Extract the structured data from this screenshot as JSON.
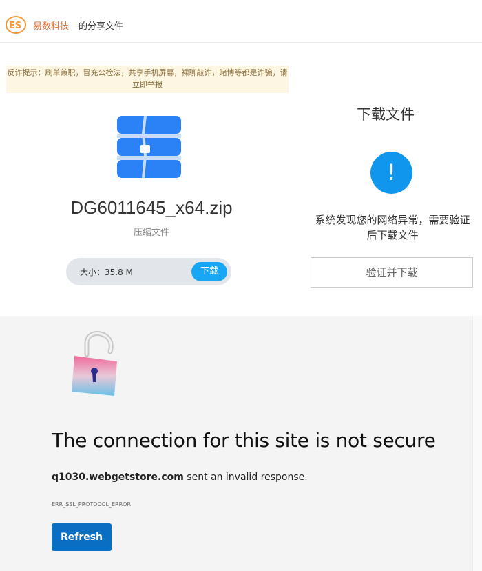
{
  "header": {
    "brand": "易数科技",
    "share_text": "的分享文件",
    "logo_icon": "es-logo-icon"
  },
  "warning": {
    "text": "反诈提示：刷单兼职，冒充公检法，共享手机屏幕，裸聊敲诈，赌博等都是诈骗，请立即举报"
  },
  "file": {
    "name": "DG6011645_x64.zip",
    "type": "压缩文件",
    "size_label": "大小：35.8 M",
    "download_label": "下载",
    "icon": "zip-archive-icon"
  },
  "download_panel": {
    "title": "下载文件",
    "alert_symbol": "!",
    "notice": "系统发现您的网络异常，需要验证后下载文件",
    "verify_label": "验证并下载"
  },
  "error_page": {
    "title": "The connection for this site is not secure",
    "host": "q1030.webgetstore.com",
    "message": " sent an invalid response.",
    "code": "ERR_SSL_PROTOCOL_ERROR",
    "refresh_label": "Refresh",
    "icon": "broken-lock-icon"
  },
  "colors": {
    "brand": "#e06a2c",
    "accent": "#17a7f5",
    "alert": "#1196ee",
    "refresh": "#0a6fc2",
    "warning_bg": "#fdf6e3"
  }
}
